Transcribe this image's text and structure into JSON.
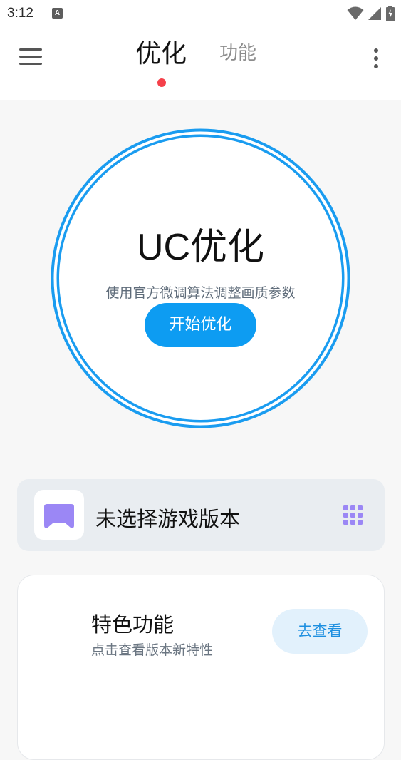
{
  "status_bar": {
    "time": "3:12",
    "notification_icon": "a-badge-icon",
    "right_icons": [
      "wifi-icon",
      "signal-icon",
      "battery-charging-icon"
    ]
  },
  "nav": {
    "menu_icon": "menu-icon",
    "tabs": [
      {
        "label": "优化",
        "active": true
      },
      {
        "label": "功能",
        "active": false
      }
    ],
    "more_icon": "more-vertical-icon",
    "indicator_color": "#f5404a"
  },
  "optimizer": {
    "title": "UC优化",
    "subtitle": "使用官方微调算法调整画质参数",
    "button_label": "开始优化",
    "accent_color": "#0d9cf2"
  },
  "game_selector": {
    "icon": "gamepad-icon",
    "label": "未选择游戏版本",
    "action_icon": "grid-icon",
    "accent_color": "#9b87f5"
  },
  "features": {
    "title": "特色功能",
    "subtitle": "点击查看版本新特性",
    "button_label": "去查看"
  }
}
